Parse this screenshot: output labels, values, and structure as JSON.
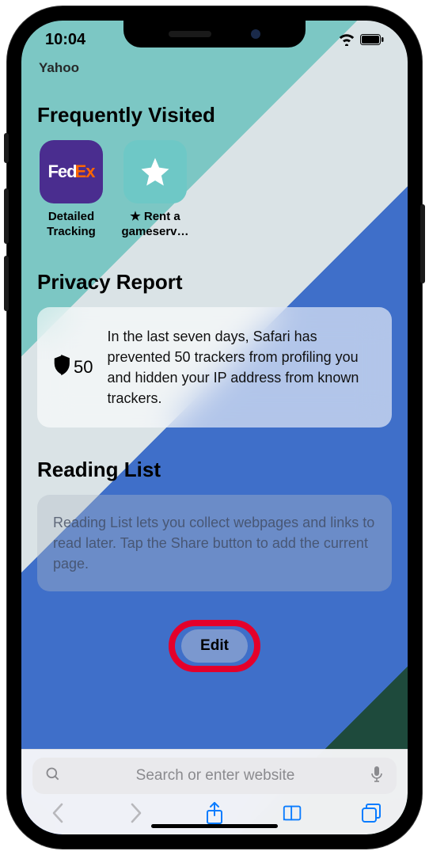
{
  "status": {
    "time": "10:04"
  },
  "cutoff_item": "Yahoo",
  "sections": {
    "frequently_visited": {
      "title": "Frequently Visited",
      "items": [
        {
          "label": "Detailed Tracking",
          "icon": "fedex"
        },
        {
          "label": "★ Rent a gameserv…",
          "icon": "star"
        }
      ]
    },
    "privacy_report": {
      "title": "Privacy Report",
      "tracker_count": "50",
      "summary": "In the last seven days, Safari has prevented 50 trackers from profiling you and hidden your IP address from known trackers."
    },
    "reading_list": {
      "title": "Reading List",
      "empty_text": "Reading List lets you collect webpages and links to read later. Tap the Share button to add the current page."
    }
  },
  "edit_button_label": "Edit",
  "bottom_bar": {
    "search_placeholder": "Search or enter website"
  },
  "annotation": {
    "highlight_target": "edit-button"
  }
}
